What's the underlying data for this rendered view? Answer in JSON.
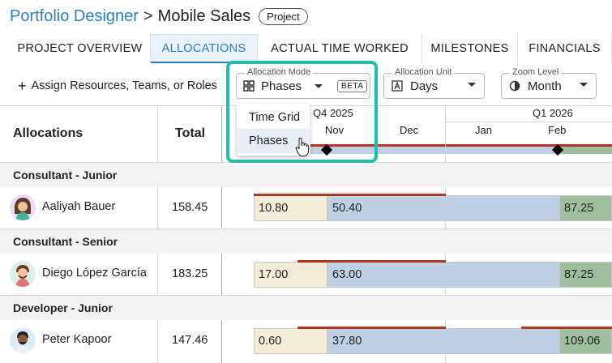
{
  "breadcrumb": {
    "parent": "Portfolio Designer",
    "separator": ">",
    "current": "Mobile Sales",
    "badge": "Project"
  },
  "tabs": [
    {
      "label": "PROJECT OVERVIEW",
      "active": false
    },
    {
      "label": "ALLOCATIONS",
      "active": true
    },
    {
      "label": "ACTUAL TIME WORKED",
      "active": false
    },
    {
      "label": "MILESTONES",
      "active": false
    },
    {
      "label": "FINANCIALS",
      "active": false
    }
  ],
  "toolbar": {
    "add_label": "Assign Resources, Teams, or Roles",
    "allocation_mode": {
      "legend": "Allocation Mode",
      "value": "Phases",
      "badge": "BETA",
      "icon": "grid-icon"
    },
    "allocation_unit": {
      "legend": "Allocation Unit",
      "value": "Days",
      "icon": "letter-a-icon"
    },
    "zoom_level": {
      "legend": "Zoom Level",
      "value": "Month",
      "icon": "half-circle-icon"
    }
  },
  "mode_menu": {
    "items": [
      "Time Grid",
      "Phases"
    ],
    "selected": "Phases"
  },
  "columns": {
    "allocations": "Allocations",
    "total": "Total"
  },
  "timeline": {
    "quarters": [
      "Q4 2025",
      "Q1 2026"
    ],
    "months": [
      "Nov",
      "Dec",
      "Jan",
      "Feb"
    ]
  },
  "groups": [
    {
      "label": "Consultant - Junior",
      "person": {
        "name": "Aaliyah Bauer",
        "total": "158.45",
        "segments": [
          "10.80",
          "50.40",
          "87.25"
        ]
      }
    },
    {
      "label": "Consultant - Senior",
      "person": {
        "name": "Diego López García",
        "total": "183.25",
        "segments": [
          "17.00",
          "63.00",
          "87.25"
        ]
      }
    },
    {
      "label": "Developer - Junior",
      "person": {
        "name": "Peter Kapoor",
        "total": "147.46",
        "segments": [
          "0.60",
          "37.80",
          "109.06"
        ]
      }
    }
  ],
  "colors": {
    "accent": "#2c7fc3",
    "highlight": "#1fbfa9",
    "phase_beige": "#f3ecd9",
    "phase_blue": "#bfd0e4",
    "phase_green": "#9fbe9e",
    "over_allocation": "#b1361e"
  }
}
